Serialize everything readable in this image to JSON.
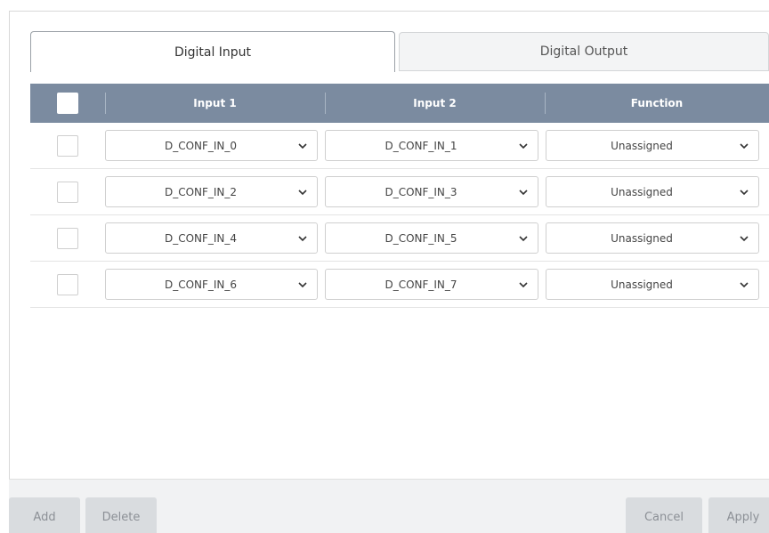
{
  "tabs": {
    "digital_input": "Digital Input",
    "digital_output": "Digital Output"
  },
  "table": {
    "headers": {
      "input1": "Input 1",
      "input2": "Input 2",
      "function": "Function"
    },
    "rows": [
      {
        "input1": "D_CONF_IN_0",
        "input2": "D_CONF_IN_1",
        "function": "Unassigned"
      },
      {
        "input1": "D_CONF_IN_2",
        "input2": "D_CONF_IN_3",
        "function": "Unassigned"
      },
      {
        "input1": "D_CONF_IN_4",
        "input2": "D_CONF_IN_5",
        "function": "Unassigned"
      },
      {
        "input1": "D_CONF_IN_6",
        "input2": "D_CONF_IN_7",
        "function": "Unassigned"
      }
    ]
  },
  "footer": {
    "add": "Add",
    "delete": "Delete",
    "cancel": "Cancel",
    "apply": "Apply"
  },
  "colors": {
    "header_bg": "#7b8ba0",
    "footer_bg": "#f1f2f3",
    "button_bg": "#d9dcdf"
  }
}
